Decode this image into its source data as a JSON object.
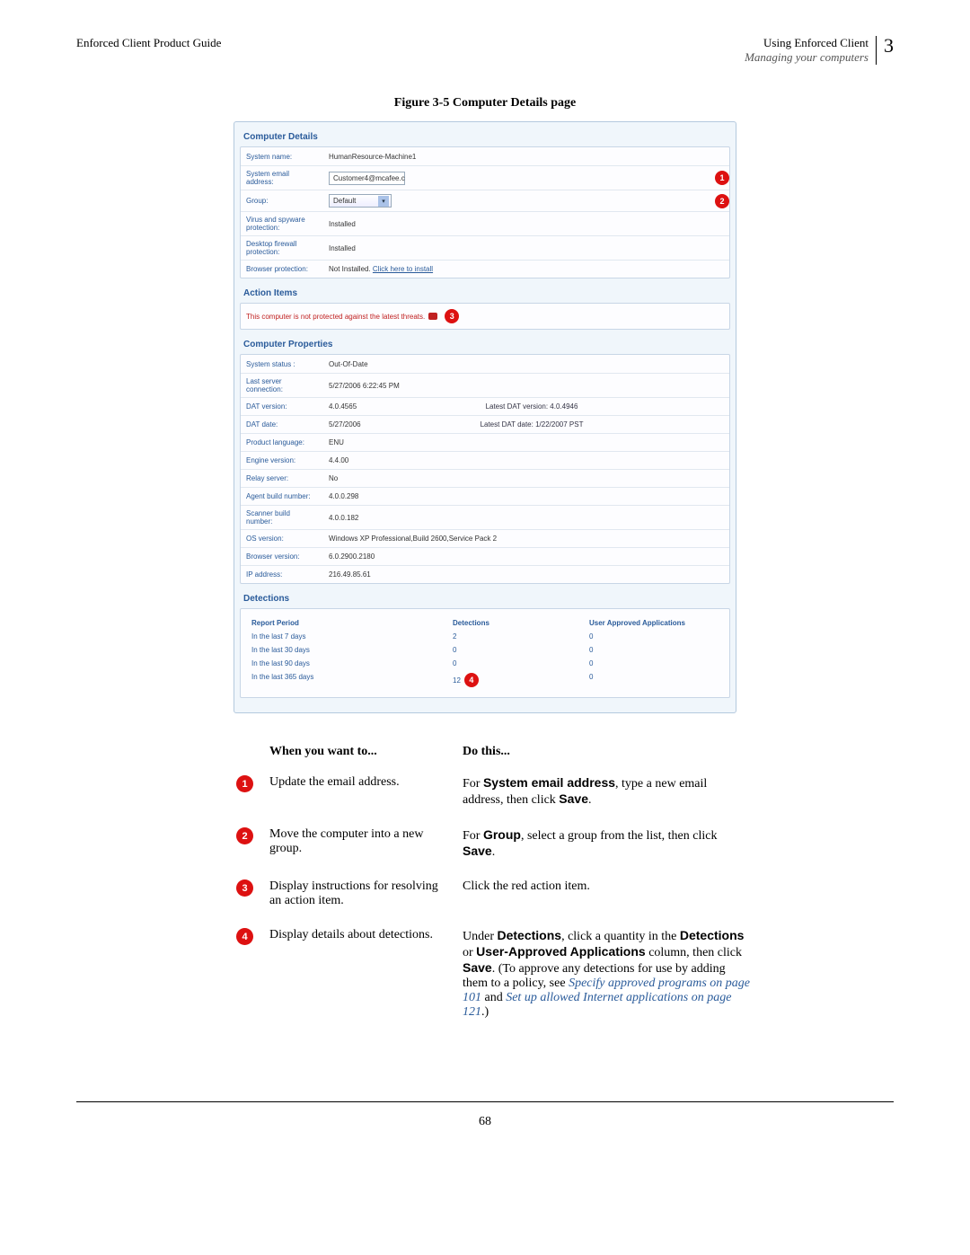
{
  "header": {
    "left": "Enforced Client Product Guide",
    "right_top": "Using Enforced Client",
    "right_sub": "Managing your computers",
    "chapter": "3"
  },
  "figure_title": "Figure 3-5  Computer Details page",
  "details": {
    "title": "Computer Details",
    "rows": [
      {
        "label": "System name:",
        "value": "HumanResource-Machine1"
      },
      {
        "label": "System email address:",
        "input": "Customer4@mcafee.c",
        "callout": "1"
      },
      {
        "label": "Group:",
        "select": "Default",
        "callout": "2"
      },
      {
        "label": "Virus and spyware protection:",
        "value": "Installed"
      },
      {
        "label": "Desktop firewall protection:",
        "value": "Installed"
      },
      {
        "label": "Browser protection:",
        "value_plain": "Not Installed. ",
        "link": "Click here to install"
      }
    ]
  },
  "action_items": {
    "title": "Action Items",
    "text": "This computer is not protected against the latest threats.",
    "callout": "3"
  },
  "properties": {
    "title": "Computer Properties",
    "rows": [
      {
        "label": "System status :",
        "value": "Out-Of-Date"
      },
      {
        "label": "Last server connection:",
        "value": "5/27/2006 6:22:45 PM"
      },
      {
        "label": "DAT version:",
        "value": "4.0.4565",
        "extra_label": "Latest DAT version:",
        "extra_value": "4.0.4946"
      },
      {
        "label": "DAT date:",
        "value": "5/27/2006",
        "extra_label": "Latest DAT date:",
        "extra_value": "1/22/2007  PST"
      },
      {
        "label": "Product language:",
        "value": "ENU"
      },
      {
        "label": "Engine version:",
        "value": "4.4.00"
      },
      {
        "label": "Relay server:",
        "value": "No"
      },
      {
        "label": "Agent build number:",
        "value": "4.0.0.298"
      },
      {
        "label": "Scanner build number:",
        "value": "4.0.0.182"
      },
      {
        "label": "OS version:",
        "value": "Windows XP Professional,Build 2600,Service Pack 2"
      },
      {
        "label": "Browser version:",
        "value": "6.0.2900.2180"
      },
      {
        "label": "IP address:",
        "value": "216.49.85.61"
      }
    ]
  },
  "detections": {
    "title": "Detections",
    "headers": [
      "Report Period",
      "Detections",
      "User Approved Applications"
    ],
    "rows": [
      {
        "period": "In the last 7 days",
        "det": "2",
        "ua": "0"
      },
      {
        "period": "In the last 30 days",
        "det": "0",
        "ua": "0"
      },
      {
        "period": "In the last 90 days",
        "det": "0",
        "ua": "0"
      },
      {
        "period": "In the last 365 days",
        "det": "12",
        "ua": "0",
        "callout": "4"
      }
    ]
  },
  "instructions": {
    "head_want": "When you want to...",
    "head_do": "Do this...",
    "rows": [
      {
        "num": "1",
        "want": "Update the email address.",
        "do_parts": [
          {
            "t": "For "
          },
          {
            "t": "System email address",
            "bold": true
          },
          {
            "t": ", type a new email address, then click "
          },
          {
            "t": "Save",
            "bold": true
          },
          {
            "t": "."
          }
        ]
      },
      {
        "num": "2",
        "want": "Move the computer into a new group.",
        "do_parts": [
          {
            "t": "For "
          },
          {
            "t": "Group",
            "bold": true
          },
          {
            "t": ", select a group from the list, then click "
          },
          {
            "t": "Save",
            "bold": true
          },
          {
            "t": "."
          }
        ]
      },
      {
        "num": "3",
        "want": "Display instructions for resolving an action item.",
        "do_parts": [
          {
            "t": "Click the red action item."
          }
        ]
      },
      {
        "num": "4",
        "want": "Display details about detections.",
        "do_parts": [
          {
            "t": "Under "
          },
          {
            "t": "Detections",
            "bold": true
          },
          {
            "t": ", click a quantity in the "
          },
          {
            "t": "Detections",
            "bold": true
          },
          {
            "t": " or "
          },
          {
            "t": "User-Approved Applications",
            "bold": true
          },
          {
            "t": " column, then click "
          },
          {
            "t": "Save",
            "bold": true
          },
          {
            "t": ". (To approve any detections for use by adding them to a policy, see "
          },
          {
            "t": "Specify approved programs",
            "link": true
          },
          {
            "t": " on page 101",
            "link": true
          },
          {
            "t": " and "
          },
          {
            "t": "Set up allowed Internet applications",
            "link": true
          },
          {
            "t": " on page 121",
            "link": true
          },
          {
            "t": ".)"
          }
        ]
      }
    ]
  },
  "pagenum": "68"
}
